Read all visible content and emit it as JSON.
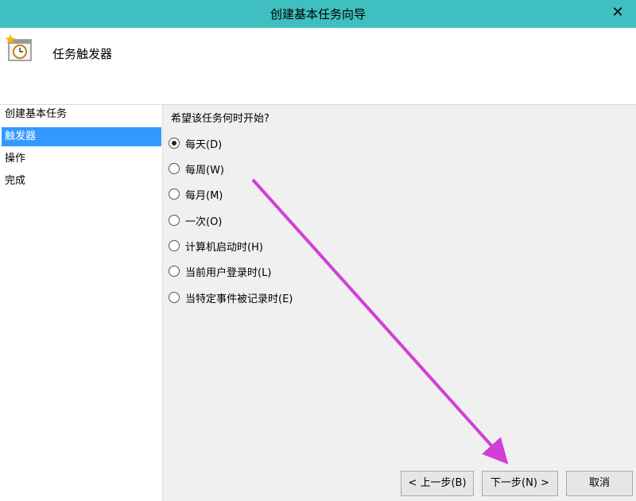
{
  "window": {
    "title": "创建基本任务向导",
    "close_label": "✕"
  },
  "header": {
    "heading": "任务触发器",
    "icon": "task-scheduler-clock-icon"
  },
  "sidebar": {
    "items": [
      {
        "label": "创建基本任务",
        "active": false
      },
      {
        "label": "触发器",
        "active": true
      },
      {
        "label": "操作",
        "active": false
      },
      {
        "label": "完成",
        "active": false
      }
    ]
  },
  "main": {
    "question": "希望该任务何时开始?",
    "options": [
      {
        "label": "每天(D)",
        "checked": true
      },
      {
        "label": "每周(W)",
        "checked": false
      },
      {
        "label": "每月(M)",
        "checked": false
      },
      {
        "label": "一次(O)",
        "checked": false
      },
      {
        "label": "计算机启动时(H)",
        "checked": false
      },
      {
        "label": "当前用户登录时(L)",
        "checked": false
      },
      {
        "label": "当特定事件被记录时(E)",
        "checked": false
      }
    ]
  },
  "buttons": {
    "back": "< 上一步(B)",
    "next": "下一步(N) >",
    "cancel": "取消"
  },
  "annotation": {
    "arrow_color": "#d23fd6"
  }
}
